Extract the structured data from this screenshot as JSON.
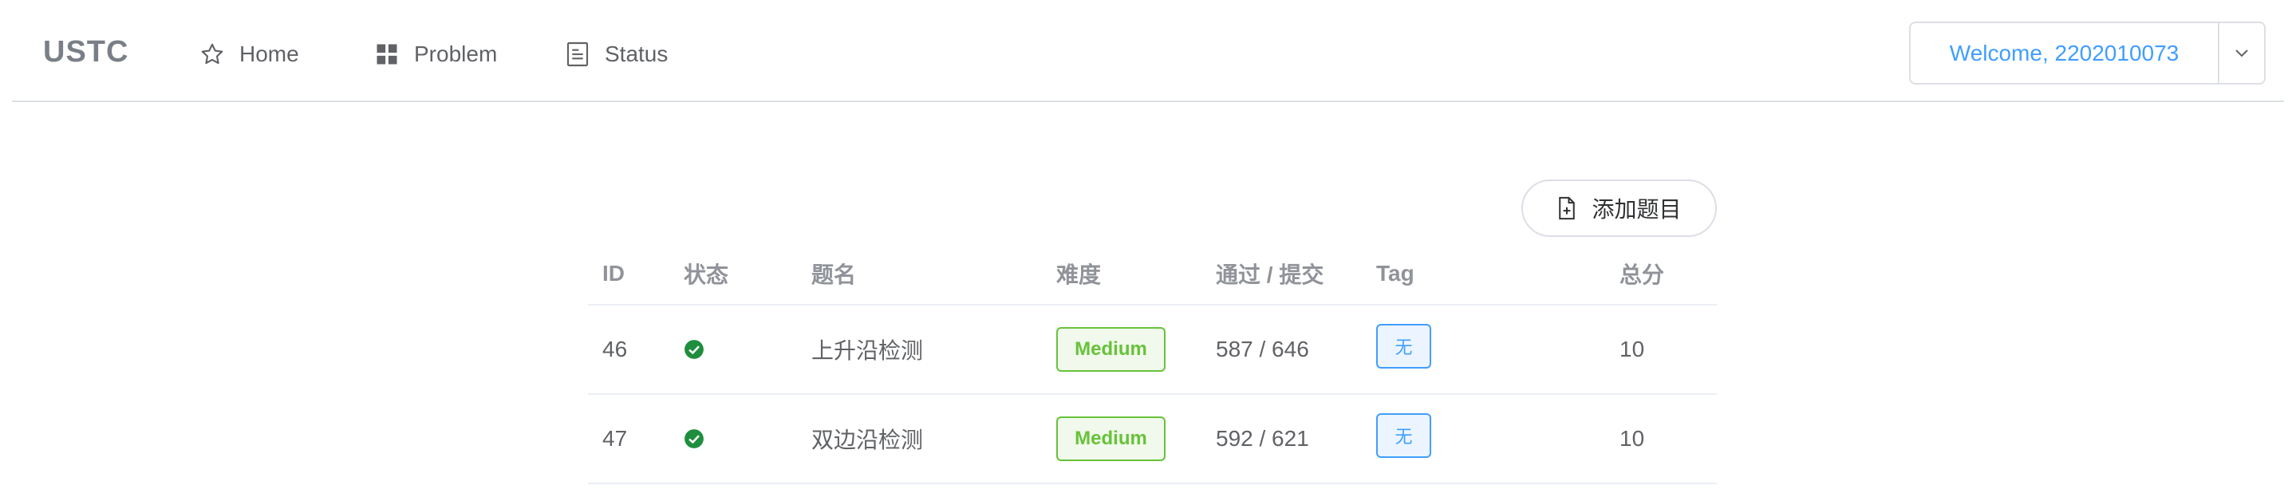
{
  "nav": {
    "brand": "USTC",
    "items": [
      {
        "label": "Home",
        "icon": "star-icon"
      },
      {
        "label": "Problem",
        "icon": "grid-icon"
      },
      {
        "label": "Status",
        "icon": "document-icon"
      }
    ],
    "user_menu_label": "Welcome, 2202010073"
  },
  "toolbar": {
    "add_label": "添加题目"
  },
  "table": {
    "headers": {
      "id": "ID",
      "status": "状态",
      "name": "题名",
      "difficulty": "难度",
      "ratio": "通过 / 提交",
      "tag": "Tag",
      "score": "总分"
    },
    "rows": [
      {
        "id": "46",
        "status": "solved",
        "name": "上升沿检测",
        "difficulty": "Medium",
        "ratio": "587 / 646",
        "tag": "无",
        "score": "10"
      },
      {
        "id": "47",
        "status": "solved",
        "name": "双边沿检测",
        "difficulty": "Medium",
        "ratio": "592 / 621",
        "tag": "无",
        "score": "10"
      }
    ]
  },
  "colors": {
    "accent": "#409eff",
    "success": "#67c23a",
    "solved_icon": "#1e8e3e"
  }
}
